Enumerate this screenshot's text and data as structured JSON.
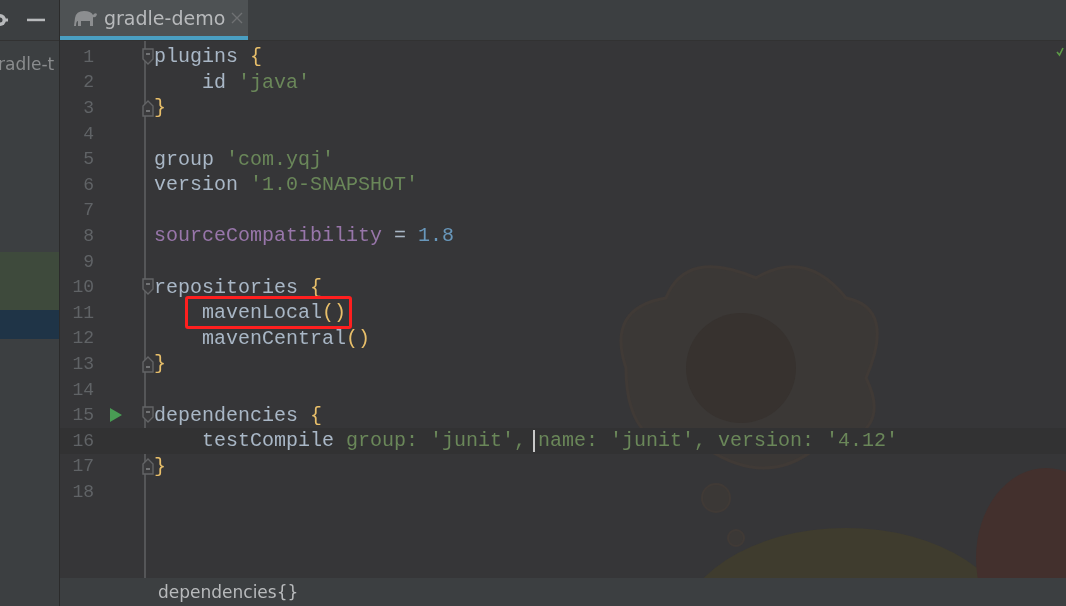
{
  "project_panel": {
    "item_label": "radle-t",
    "rows": [
      {
        "kind": "blank"
      },
      {
        "kind": "blank"
      },
      {
        "kind": "blank"
      },
      {
        "kind": "blank"
      },
      {
        "kind": "blank"
      },
      {
        "kind": "blank"
      },
      {
        "kind": "blank"
      },
      {
        "kind": "changed"
      },
      {
        "kind": "changed"
      },
      {
        "kind": "selected"
      }
    ]
  },
  "tabs": [
    {
      "label": "gradle-demo",
      "selected": true
    }
  ],
  "lines": [
    {
      "number": "1",
      "fold_start": true,
      "tokens": [
        {
          "kind": "plain",
          "text": "plugins "
        },
        {
          "kind": "brace",
          "text": "{"
        }
      ]
    },
    {
      "number": "2",
      "tokens": [
        {
          "kind": "plain",
          "text": "    id "
        },
        {
          "kind": "str",
          "text": "'java'"
        }
      ]
    },
    {
      "number": "3",
      "fold_end": true,
      "tokens": [
        {
          "kind": "brace",
          "text": "}"
        }
      ]
    },
    {
      "number": "4"
    },
    {
      "number": "5",
      "tokens": [
        {
          "kind": "plain",
          "text": "group "
        },
        {
          "kind": "str",
          "text": "'com.yqj'"
        }
      ]
    },
    {
      "number": "6",
      "tokens": [
        {
          "kind": "plain",
          "text": "version "
        },
        {
          "kind": "str",
          "text": "'1.0-SNAPSHOT'"
        }
      ]
    },
    {
      "number": "7"
    },
    {
      "number": "8",
      "tokens": [
        {
          "kind": "prop",
          "text": "sourceCompatibility"
        },
        {
          "kind": "plain",
          "text": " = "
        },
        {
          "kind": "num",
          "text": "1.8"
        }
      ]
    },
    {
      "number": "9"
    },
    {
      "number": "10",
      "fold_start": true,
      "tokens": [
        {
          "kind": "plain",
          "text": "repositories "
        },
        {
          "kind": "brace",
          "text": "{"
        }
      ]
    },
    {
      "number": "11",
      "boxed": true,
      "tokens": [
        {
          "kind": "plain",
          "text": "    mavenLocal"
        },
        {
          "kind": "brace",
          "text": "()"
        }
      ]
    },
    {
      "number": "12",
      "tokens": [
        {
          "kind": "plain",
          "text": "    mavenCentral"
        },
        {
          "kind": "brace",
          "text": "()"
        }
      ]
    },
    {
      "number": "13",
      "fold_end": true,
      "tokens": [
        {
          "kind": "brace",
          "text": "}"
        }
      ]
    },
    {
      "number": "14"
    },
    {
      "number": "15",
      "fold_start": true,
      "run": true,
      "tokens": [
        {
          "kind": "plain",
          "text": "dependencies "
        },
        {
          "kind": "brace",
          "text": "{"
        }
      ]
    },
    {
      "number": "16",
      "current": true,
      "tokens": [
        {
          "kind": "plain",
          "text": "    testCompile "
        },
        {
          "kind": "str",
          "text": "group: 'junit', "
        },
        {
          "kind": "str",
          "text": "name: 'junit', version: '4.12'",
          "caret": true
        }
      ]
    },
    {
      "number": "17",
      "fold_end": true,
      "tokens": [
        {
          "kind": "brace",
          "text": "}"
        }
      ]
    },
    {
      "number": "18"
    }
  ],
  "breadcrumb": "dependencies{}"
}
